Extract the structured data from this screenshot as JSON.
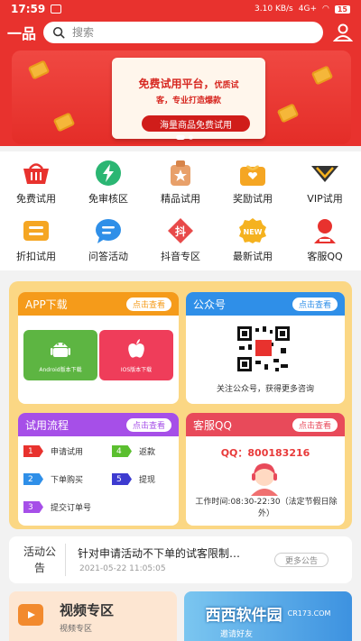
{
  "status_bar": {
    "time": "17:59",
    "network": "3.10 KB/s",
    "signal": "4G+ ",
    "battery": "15"
  },
  "header": {
    "logo": "一品",
    "search_placeholder": "搜索"
  },
  "banner": {
    "title": "免费试用平台，",
    "title_small": "优质试",
    "subtitle": "客，专业打造爆款",
    "button": "海量商品免费试用"
  },
  "categories": [
    {
      "label": "免费试用",
      "icon": "basket-icon",
      "color": "#e8322e"
    },
    {
      "label": "免审核区",
      "icon": "lightning-icon",
      "color": "#2bb673"
    },
    {
      "label": "精品试用",
      "icon": "star-bag-icon",
      "color": "#e8a06a"
    },
    {
      "label": "奖励试用",
      "icon": "gift-icon",
      "color": "#f5a623"
    },
    {
      "label": "VIP试用",
      "icon": "diamond-icon",
      "color": "#333333"
    },
    {
      "label": "折扣试用",
      "icon": "ticket-icon",
      "color": "#f5a623"
    },
    {
      "label": "问答活动",
      "icon": "chat-icon",
      "color": "#2f8fe8"
    },
    {
      "label": "抖音专区",
      "icon": "douyin-icon",
      "color": "#e84a4a"
    },
    {
      "label": "最新试用",
      "icon": "new-badge-icon",
      "color": "#f5b21f"
    },
    {
      "label": "客服QQ",
      "icon": "agent-icon",
      "color": "#e8322e"
    }
  ],
  "panel": {
    "app": {
      "title": "APP下载",
      "more": "点击查看",
      "android": "Android版本下载",
      "ios": "IOS版本下载"
    },
    "wechat": {
      "title": "公众号",
      "more": "点击查看",
      "caption": "关注公众号，获得更多咨询"
    },
    "process": {
      "title": "试用流程",
      "more": "点击查看",
      "steps": [
        {
          "num": "1",
          "label": "申请试用",
          "color": "#e8322e"
        },
        {
          "num": "2",
          "label": "下单购买",
          "color": "#2f8fe8"
        },
        {
          "num": "3",
          "label": "提交订单号",
          "color": "#a64fe8"
        },
        {
          "num": "4",
          "label": "返款",
          "color": "#5bbf2f"
        },
        {
          "num": "5",
          "label": "提现",
          "color": "#3d3bd0"
        }
      ]
    },
    "service": {
      "title": "客服QQ",
      "more": "点击查看",
      "qq": "QQ：800183216",
      "hours": "工作时间:08:30-22:30（法定节假日除外）"
    }
  },
  "notice": {
    "label": "活动公告",
    "text": "针对申请活动不下单的试客限制…",
    "date": "2021-05-22 11:05:05",
    "more": "更多公告"
  },
  "bottom": {
    "video_title": "视频专区",
    "video_sub": "视频专区",
    "invite": "邀请好友",
    "watermark": "西西软件园",
    "watermark_sub": "CR173.COM"
  },
  "colors": {
    "primary_red": "#e8322e",
    "panel_yellow": "#fbd784",
    "app_orange": "#f59b1a",
    "wechat_blue": "#2f8fe8",
    "process_purple": "#a64fe8",
    "service_red": "#e84a5a"
  }
}
